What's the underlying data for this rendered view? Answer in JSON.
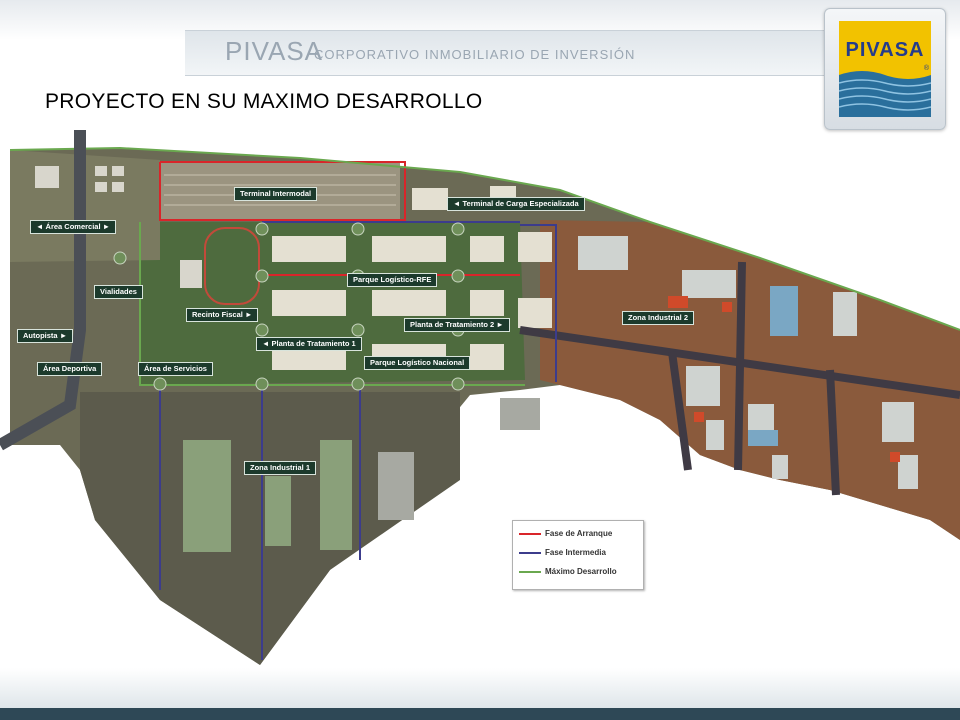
{
  "header": {
    "brand": "PIVASA",
    "subtitle": "CORPORATIVO INMOBILIARIO DE INVERSIÓN",
    "logo_text": "PIVASA",
    "logo_mark": "®"
  },
  "title": "PROYECTO EN SU MAXIMO DESARROLLO",
  "map": {
    "labels": {
      "terminal_intermodal": "Terminal Intermodal",
      "terminal_carga": "Terminal de Carga Especializada",
      "area_comercial": "Área Comercial",
      "parque_logistico_rfe": "Parque Logístico-RFE",
      "vialidades": "Vialidades",
      "recinto_fiscal": "Recinto Fiscal",
      "planta_tratamiento_2": "Planta de Tratamiento 2",
      "zona_industrial_2": "Zona Industrial 2",
      "autopista": "Autopista",
      "planta_tratamiento_1": "Planta de Tratamiento 1",
      "parque_logistico_nacional": "Parque Logístico Nacional",
      "area_deportiva": "Área Deportiva",
      "area_servicios": "Área de Servicios",
      "zona_industrial_1": "Zona Industrial 1"
    },
    "arrows": {
      "left": "◄",
      "right": "►"
    }
  },
  "legend": {
    "items": [
      {
        "label": "Fase de Arranque",
        "color": "#d9252a"
      },
      {
        "label": "Fase Intermedia",
        "color": "#3c3c8c"
      },
      {
        "label": "Máximo Desarrollo",
        "color": "#6aa84f"
      }
    ]
  },
  "colors": {
    "accent_blue": "#243c8c",
    "label_bg": "#1c3a2c",
    "logo_yellow": "#f2c200",
    "water_blue": "#2a6f9c"
  }
}
